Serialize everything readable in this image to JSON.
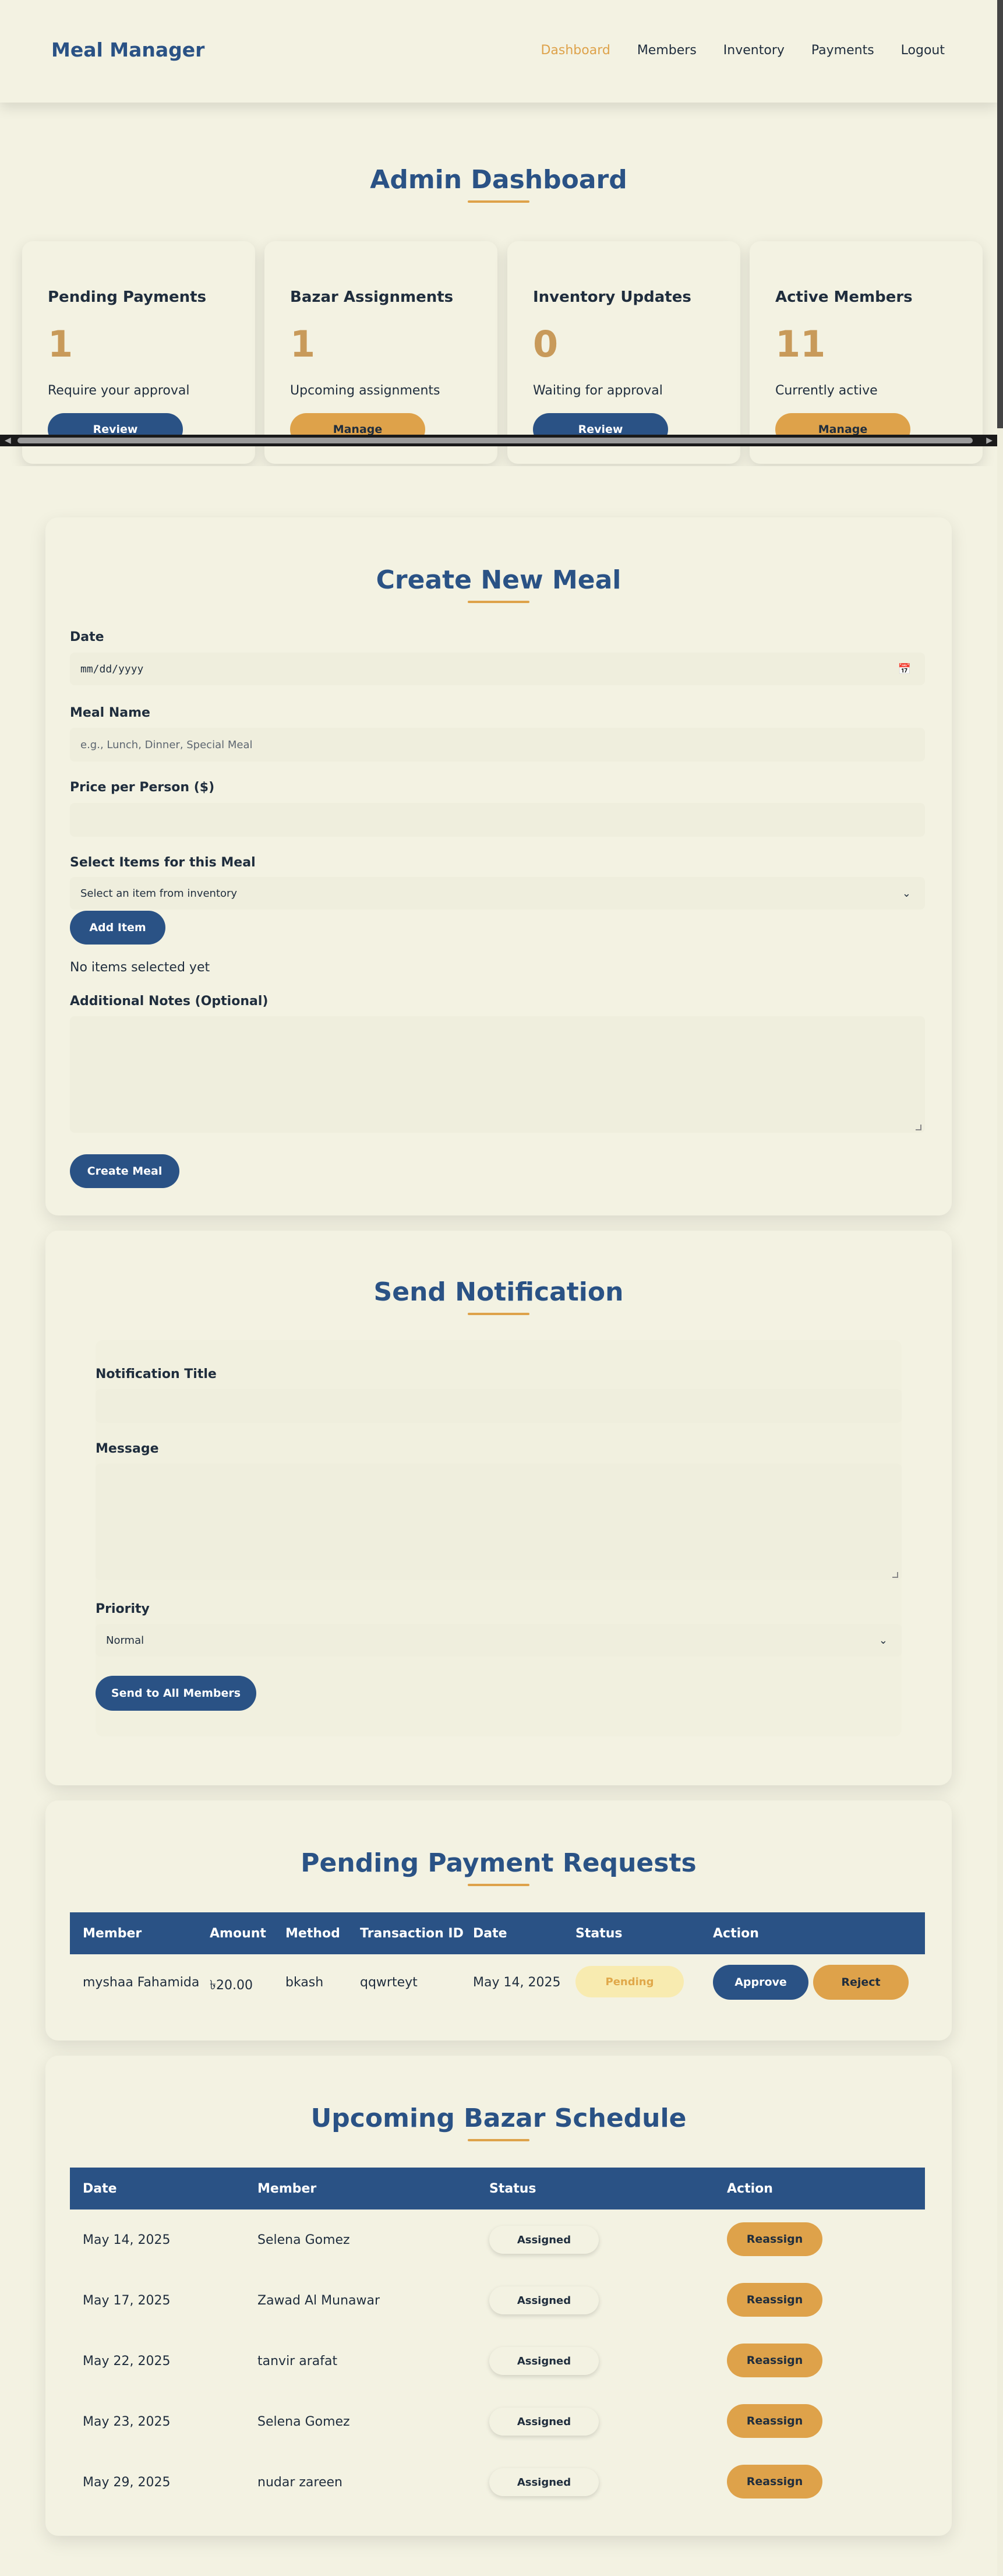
{
  "nav": {
    "brand": "Meal Manager",
    "links": [
      "Dashboard",
      "Members",
      "Inventory",
      "Payments",
      "Logout"
    ],
    "active": "Dashboard"
  },
  "dashboard": {
    "title": "Admin Dashboard",
    "cards": [
      {
        "title": "Pending Payments",
        "value": "1",
        "subtitle": "Require your approval",
        "button": "Review"
      },
      {
        "title": "Bazar Assignments",
        "value": "1",
        "subtitle": "Upcoming assignments",
        "button": "Manage"
      },
      {
        "title": "Inventory Updates",
        "value": "0",
        "subtitle": "Waiting for approval",
        "button": "Review"
      },
      {
        "title": "Active Members",
        "value": "11",
        "subtitle": "Currently active",
        "button": "Manage"
      }
    ]
  },
  "create_meal": {
    "title": "Create New Meal",
    "date_label": "Date",
    "date_placeholder": "mm/dd/yyyy",
    "meal_name_label": "Meal Name",
    "meal_name_placeholder": "e.g., Lunch, Dinner, Special Meal",
    "price_label": "Price per Person ($)",
    "items_label": "Select Items for this Meal",
    "items_select_value": "Select an item from inventory",
    "add_item_button": "Add Item",
    "no_items_text": "No items selected yet",
    "notes_label": "Additional Notes (Optional)",
    "submit_button": "Create Meal"
  },
  "notification": {
    "title": "Send Notification",
    "title_label": "Notification Title",
    "message_label": "Message",
    "priority_label": "Priority",
    "priority_value": "Normal",
    "send_button": "Send to All Members"
  },
  "payments": {
    "title": "Pending Payment Requests",
    "columns": [
      "Member",
      "Amount",
      "Method",
      "Transaction ID",
      "Date",
      "Status",
      "Action"
    ],
    "rows": [
      {
        "member": "myshaa Fahamida",
        "amount": "৳20.00",
        "method": "bkash",
        "txn": "qqwrteyt",
        "date": "May 14, 2025",
        "status": "Pending",
        "approve": "Approve",
        "reject": "Reject"
      }
    ]
  },
  "bazar": {
    "title": "Upcoming Bazar Schedule",
    "columns": [
      "Date",
      "Member",
      "Status",
      "Action"
    ],
    "rows": [
      {
        "date": "May 14, 2025",
        "member": "Selena Gomez",
        "status": "Assigned",
        "action": "Reassign"
      },
      {
        "date": "May 17, 2025",
        "member": "Zawad Al Munawar",
        "status": "Assigned",
        "action": "Reassign"
      },
      {
        "date": "May 22, 2025",
        "member": "tanvir arafat",
        "status": "Assigned",
        "action": "Reassign"
      },
      {
        "date": "May 23, 2025",
        "member": "Selena Gomez",
        "status": "Assigned",
        "action": "Reassign"
      },
      {
        "date": "May 29, 2025",
        "member": "nudar zareen",
        "status": "Assigned",
        "action": "Reassign"
      }
    ]
  },
  "colors": {
    "primary": "#2a5285",
    "accent": "#dea24a",
    "background": "#f3f2e2"
  }
}
